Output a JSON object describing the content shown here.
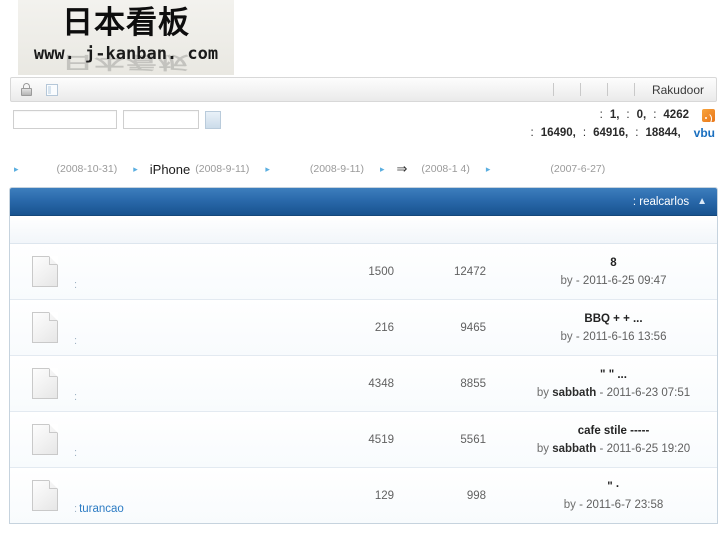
{
  "site": {
    "logo_cjk": "日本看板",
    "logo_url": "www. j-kanban. com"
  },
  "toolbar": {
    "lock_icon": "lock-icon",
    "window_icon": "window-icon",
    "right_link": "Rakudoor"
  },
  "stats": {
    "line1": [
      {
        "label": ":",
        "value": "1,"
      },
      {
        "label": ":",
        "value": "0,"
      },
      {
        "label": ":",
        "value": "4262"
      }
    ],
    "line2": [
      {
        "label": ":",
        "value": "16490,"
      },
      {
        "label": ":",
        "value": "64916,"
      },
      {
        "label": ":",
        "value": "18844,"
      }
    ],
    "rss_icon": "rss-icon",
    "user_link": "vbu"
  },
  "search": {
    "field1_value": "",
    "field1_placeholder": "",
    "field2_value": "",
    "field2_placeholder": "",
    "go_label": ""
  },
  "breadcrumbs": [
    {
      "marker": "▸",
      "text": "",
      "date": "(2008-10-31)"
    },
    {
      "marker": "▸",
      "text": "iPhone",
      "date": "(2008-9-11)"
    },
    {
      "marker": "▸",
      "text": "",
      "date": "(2008-9-11)"
    },
    {
      "marker": "▸",
      "text": "⇒",
      "date": "(2008-1 4)"
    },
    {
      "marker": "▸",
      "text": "",
      "date": "(2007-6-27)"
    }
  ],
  "panel": {
    "header_label": ": realcarlos",
    "header_caret": "▲"
  },
  "rows": [
    {
      "icon": "document-icon",
      "forum_prefix": ":",
      "forum_name": "",
      "count1": "1500",
      "count2": "12472",
      "last_title": "8",
      "by": "by",
      "author": "",
      "dash": "-",
      "datetime": "2011-6-25 09:47"
    },
    {
      "icon": "document-icon",
      "forum_prefix": ":",
      "forum_name": "",
      "count1": "216",
      "count2": "9465",
      "last_title": "BBQ +  + ...",
      "by": "by",
      "author": "",
      "dash": "-",
      "datetime": "2011-6-16 13:56"
    },
    {
      "icon": "document-icon",
      "forum_prefix": ":",
      "forum_name": "",
      "count1": "4348",
      "count2": "8855",
      "last_title": "\"  \" ...",
      "by": "by",
      "author": "sabbath",
      "dash": "-",
      "datetime": "2011-6-23 07:51"
    },
    {
      "icon": "document-icon",
      "forum_prefix": ":",
      "forum_name": "",
      "count1": "4519",
      "count2": "5561",
      "last_title": "cafe stile -----",
      "by": "by",
      "author": "sabbath",
      "dash": "-",
      "datetime": "2011-6-25 19:20"
    },
    {
      "icon": "document-icon",
      "forum_prefix": ":",
      "forum_name": "turancao",
      "count1": "129",
      "count2": "998",
      "last_title": "\" ·",
      "by": "by",
      "author": "",
      "dash": "-",
      "datetime": "2011-6-7 23:58"
    }
  ]
}
